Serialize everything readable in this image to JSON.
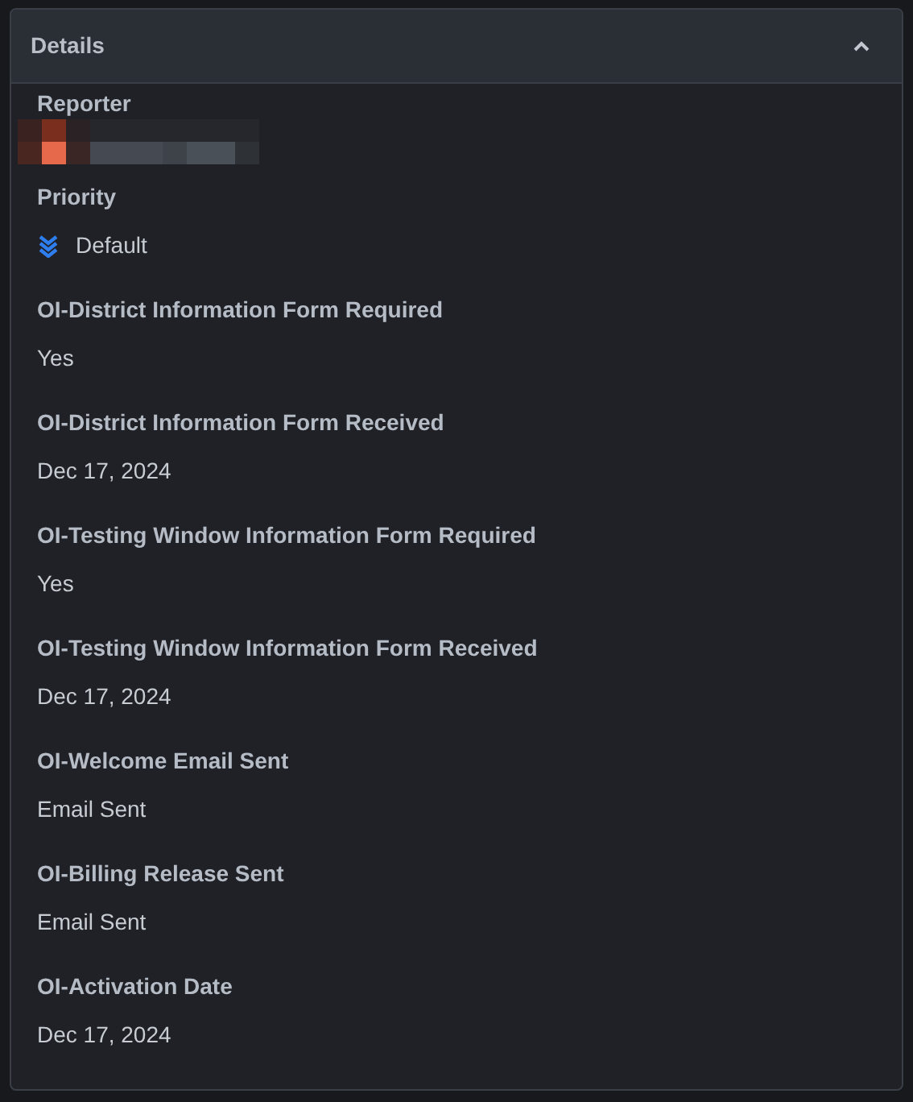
{
  "panel": {
    "title": "Details",
    "expanded": true
  },
  "fields": [
    {
      "kind": "redacted",
      "label": "Reporter"
    },
    {
      "kind": "priority",
      "label": "Priority",
      "value": "Default"
    },
    {
      "kind": "text",
      "label": "OI-District Information Form Required",
      "value": "Yes"
    },
    {
      "kind": "text",
      "label": "OI-District Information Form Received",
      "value": "Dec 17, 2024"
    },
    {
      "kind": "text",
      "label": "OI-Testing Window Information Form Required",
      "value": "Yes"
    },
    {
      "kind": "text",
      "label": "OI-Testing Window Information Form Received",
      "value": "Dec 17, 2024"
    },
    {
      "kind": "text",
      "label": "OI-Welcome Email Sent",
      "value": "Email Sent"
    },
    {
      "kind": "text",
      "label": "OI-Billing Release Sent",
      "value": "Email Sent"
    },
    {
      "kind": "text",
      "label": "OI-Activation Date",
      "value": "Dec 17, 2024"
    }
  ]
}
